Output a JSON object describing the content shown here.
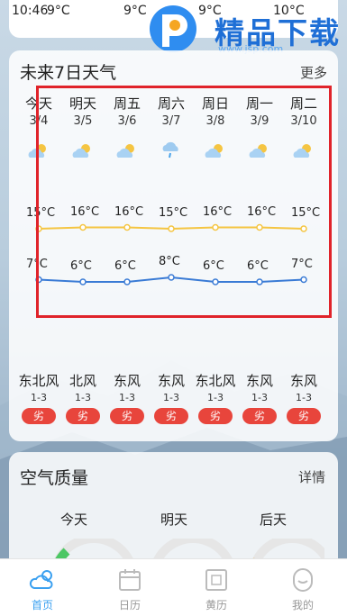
{
  "status": {
    "time": "10:46",
    "temps": [
      "9°C",
      "9°C",
      "9°C",
      "10°C"
    ]
  },
  "watermark": {
    "brand": "精品下载",
    "url": "www.jsp.com"
  },
  "forecast": {
    "title": "未来7日天气",
    "more": "更多",
    "days": [
      {
        "name": "今天",
        "date": "3/4",
        "icon": "partly-cloudy-icon",
        "high": "15°C",
        "low": "7°C",
        "wind": "东北风",
        "level": "1-3",
        "aqi": "劣"
      },
      {
        "name": "明天",
        "date": "3/5",
        "icon": "partly-cloudy-icon",
        "high": "16°C",
        "low": "6°C",
        "wind": "北风",
        "level": "1-3",
        "aqi": "劣"
      },
      {
        "name": "周五",
        "date": "3/6",
        "icon": "partly-cloudy-icon",
        "high": "16°C",
        "low": "6°C",
        "wind": "东风",
        "level": "1-3",
        "aqi": "劣"
      },
      {
        "name": "周六",
        "date": "3/7",
        "icon": "rain-icon",
        "high": "15°C",
        "low": "8°C",
        "wind": "东风",
        "level": "1-3",
        "aqi": "劣"
      },
      {
        "name": "周日",
        "date": "3/8",
        "icon": "partly-cloudy-icon",
        "high": "16°C",
        "low": "6°C",
        "wind": "东北风",
        "level": "1-3",
        "aqi": "劣"
      },
      {
        "name": "周一",
        "date": "3/9",
        "icon": "partly-cloudy-icon",
        "high": "16°C",
        "low": "6°C",
        "wind": "东风",
        "level": "1-3",
        "aqi": "劣"
      },
      {
        "name": "周二",
        "date": "3/10",
        "icon": "partly-cloudy-icon",
        "high": "15°C",
        "low": "7°C",
        "wind": "东风",
        "level": "1-3",
        "aqi": "劣"
      }
    ],
    "high_values": [
      15,
      16,
      16,
      15,
      16,
      16,
      15
    ],
    "low_values": [
      7,
      6,
      6,
      8,
      6,
      6,
      7
    ],
    "colors": {
      "high_line": "#f5c542",
      "low_line": "#3a7bd5",
      "aqi_badge": "#e8453c",
      "highlight": "#e0232a"
    }
  },
  "air_quality": {
    "title": "空气质量",
    "more": "详情",
    "days": [
      "今天",
      "明天",
      "后天"
    ]
  },
  "tabbar": {
    "active_color": "#3aa0f0",
    "tabs": [
      {
        "label": "首页",
        "icon": "cloud-sun-icon",
        "active": true
      },
      {
        "label": "日历",
        "icon": "calendar-icon",
        "active": false
      },
      {
        "label": "黄历",
        "icon": "almanac-icon",
        "active": false
      },
      {
        "label": "我的",
        "icon": "profile-icon",
        "active": false
      }
    ]
  }
}
